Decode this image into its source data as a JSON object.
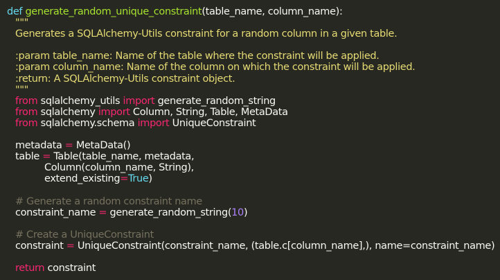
{
  "code": {
    "line1": {
      "kw_def": "def",
      "fn_name": "generate_random_unique_constraint",
      "params": "(table_name, column_name):"
    },
    "line2": "\"\"\"",
    "line3": "Generates a SQLAlchemy-Utils constraint for a random column in a given table.",
    "line5": ":param table_name: Name of the table where the constraint will be applied.",
    "line6": ":param column_name: Name of the column on which the constraint will be applied.",
    "line7": ":return: A SQLAlchemy-Utils constraint object.",
    "line8": "\"\"\"",
    "line9": {
      "from": "from",
      "module": "sqlalchemy_utils",
      "import": "import",
      "names": "generate_random_string"
    },
    "line10": {
      "from": "from",
      "module": "sqlalchemy",
      "import": "import",
      "names": "Column, String, Table, MetaData"
    },
    "line11": {
      "from": "from",
      "module": "sqlalchemy.schema",
      "import": "import",
      "names": "UniqueConstraint"
    },
    "line13": {
      "lhs": "metadata",
      "op": "=",
      "rhs": "MetaData()"
    },
    "line14": {
      "lhs": "table",
      "op": "=",
      "rhs": "Table(table_name, metadata,"
    },
    "line15": "Column(column_name, String),",
    "line16": {
      "kwarg": "extend_existing",
      "op": "=",
      "value": "True",
      "close": ")"
    },
    "line18": "# Generate a random constraint name",
    "line19": {
      "lhs": "constraint_name",
      "op": "=",
      "call": "generate_random_string(",
      "num": "10",
      "close": ")"
    },
    "line21": "# Create a UniqueConstraint",
    "line22": {
      "lhs": "constraint",
      "op": "=",
      "rhs": "UniqueConstraint(constraint_name, (table.c[column_name],), name=constraint_name)"
    },
    "line24": {
      "kw_return": "return",
      "value": "constraint"
    }
  }
}
